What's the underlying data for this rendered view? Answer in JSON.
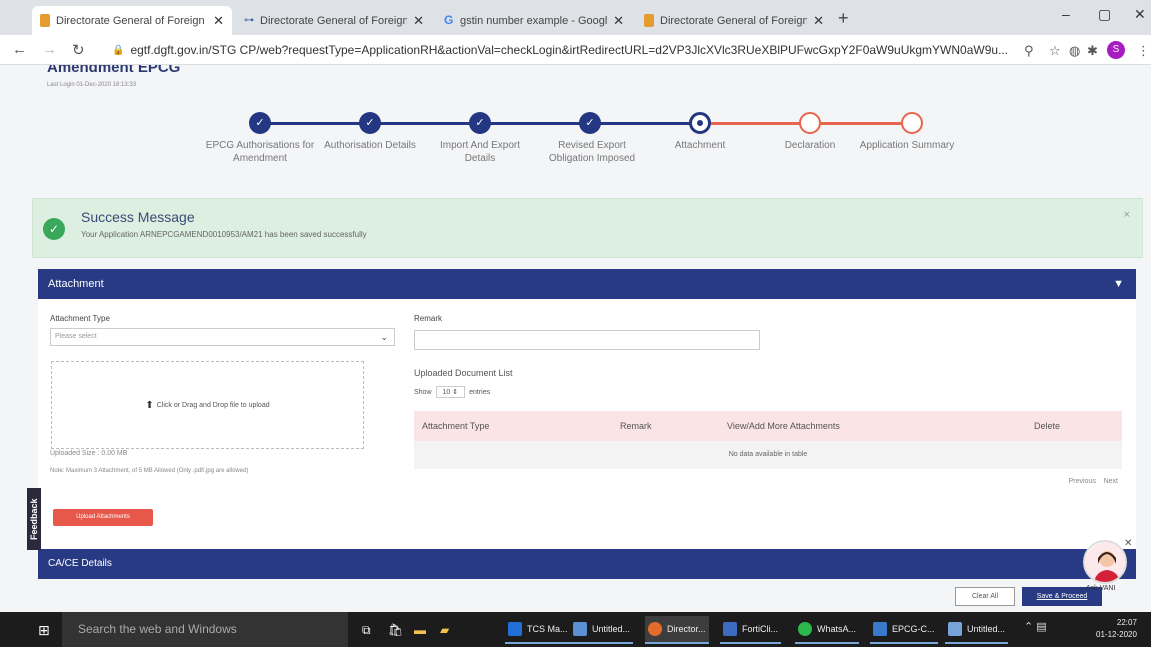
{
  "browser": {
    "tabs": [
      {
        "title": "Directorate General of Foreign Tr",
        "active": true
      },
      {
        "title": "Directorate General of Foreign Tr",
        "active": false
      },
      {
        "title": "gstin number example - Google",
        "active": false
      },
      {
        "title": "Directorate General of Foreign Tr",
        "active": false
      }
    ],
    "new_tab": "+",
    "url": "egtf.dgft.gov.in/STG CP/web?requestType=ApplicationRH&actionVal=checkLogin&irtRedirectURL=d2VP3JlcXVlc3RUeXBlPUFwcGxpY2F0aW9uUkgmYWN0aW9u...",
    "profile_initial": "S"
  },
  "page": {
    "title": "Amendment EPCG",
    "last_login": "Last Login 01-Dec-2020 18:13:33"
  },
  "stepper": {
    "steps": [
      {
        "label": "EPCG Authorisations for Amendment",
        "state": "done"
      },
      {
        "label": "Authorisation Details",
        "state": "done"
      },
      {
        "label": "Import And Export Details",
        "state": "done"
      },
      {
        "label": "Revised Export Obligation Imposed",
        "state": "done"
      },
      {
        "label": "Attachment",
        "state": "current"
      },
      {
        "label": "Declaration",
        "state": "todo"
      },
      {
        "label": "Application Summary",
        "state": "todo"
      }
    ]
  },
  "success": {
    "heading": "Success Message",
    "message": "Your Application ARNEPCGAMEND0010953/AM21 has been saved successfully",
    "close": "×"
  },
  "attachment": {
    "header": "Attachment",
    "type_label": "Attachment Type",
    "type_placeholder": "Please select",
    "remark_label": "Remark",
    "drop_text": "Click or Drag and Drop file to upload",
    "uploaded_size": "Uploaded Size : 0.00 MB",
    "note": "Note: Maximum 3 Attachment, of 5 MB Allowed (Only .pdf/.jpg are allowed)",
    "doc_list_title": "Uploaded Document List",
    "show_label": "Show",
    "show_value": "10",
    "entries_label": "entries",
    "columns": [
      "Attachment Type",
      "Remark",
      "View/Add More Attachments",
      "Delete"
    ],
    "empty_text": "No data available in table",
    "prev": "Previous",
    "next": "Next",
    "upload_button": "Upload Attachments"
  },
  "feedback": "Feedback",
  "ca_section": "CA/CE Details",
  "actions": {
    "clear": "Clear All",
    "save": "Save & Proceed"
  },
  "assistant": {
    "label": "Ask VANI"
  },
  "taskbar": {
    "search": "Search the web and Windows",
    "apps": [
      {
        "label": "TCS Ma...",
        "color": "#1f6fd6"
      },
      {
        "label": "Untitled...",
        "color": "#5b8fd6"
      },
      {
        "label": "Director...",
        "color": "#e36c2a"
      },
      {
        "label": "FortiCli...",
        "color": "#3c6bbf"
      },
      {
        "label": "WhatsA...",
        "color": "#2db84d"
      },
      {
        "label": "EPCG-C...",
        "color": "#3a78c9"
      },
      {
        "label": "Untitled...",
        "color": "#77a3d8"
      }
    ],
    "time": "22:07",
    "date": "01-12-2020"
  }
}
